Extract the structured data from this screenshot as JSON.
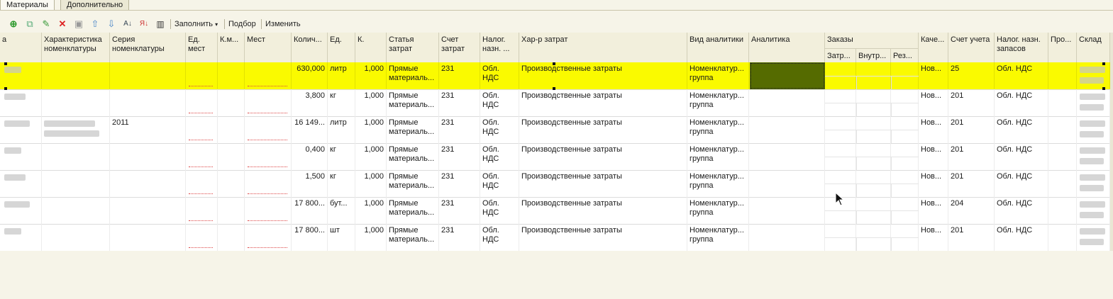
{
  "tabs": [
    {
      "label": "Материалы",
      "active": true
    },
    {
      "label": "Дополнительно",
      "active": false
    }
  ],
  "toolbar": {
    "icons": [
      "add-icon",
      "copy-icon",
      "edit-icon",
      "delete-icon",
      "save-icon",
      "move-up-icon",
      "move-down-icon",
      "sort-asc-icon",
      "sort-desc-icon",
      "barcode-icon"
    ],
    "fill_label": "Заполнить",
    "pick_label": "Подбор",
    "change_label": "Изменить"
  },
  "columns": {
    "a": "а",
    "char": "Характеристика номенклатуры",
    "series": "Серия номенклатуры",
    "unit_places": "Ед. мест",
    "k_places": "К.м...",
    "places": "Мест",
    "qty": "Колич...",
    "unit": "Ед.",
    "k": "К.",
    "cost_item": "Статья затрат",
    "cost_account": "Счет затрат",
    "tax": "Налог. назн. ...",
    "cost_nature": "Хар-р затрат",
    "analytics_type": "Вид аналитики",
    "analytics": "Аналитика",
    "orders": "Заказы",
    "orders_sub": [
      "Затр...",
      "Внутр...",
      "Рез..."
    ],
    "quality": "Каче...",
    "account": "Счет учета",
    "stock_tax": "Налог. назн. запасов",
    "pro": "Про...",
    "warehouse": "Склад"
  },
  "rows": [
    {
      "series": "",
      "qty": "630,000",
      "unit": "литр",
      "k": "1,000",
      "cost_item": "Прямые материаль...",
      "cost_account": "231",
      "tax": "Обл. НДС",
      "cost_nature": "Производственные затраты",
      "analytics_type": "Номенклатур... группа",
      "quality": "Нов...",
      "account": "25",
      "stock_tax": "Обл. НДС"
    },
    {
      "series": "",
      "qty": "3,800",
      "unit": "кг",
      "k": "1,000",
      "cost_item": "Прямые материаль...",
      "cost_account": "231",
      "tax": "Обл. НДС",
      "cost_nature": "Производственные затраты",
      "analytics_type": "Номенклатур... группа",
      "quality": "Нов...",
      "account": "201",
      "stock_tax": "Обл. НДС"
    },
    {
      "series": "2011",
      "qty": "16 149...",
      "unit": "литр",
      "k": "1,000",
      "cost_item": "Прямые материаль...",
      "cost_account": "231",
      "tax": "Обл. НДС",
      "cost_nature": "Производственные затраты",
      "analytics_type": "Номенклатур... группа",
      "quality": "Нов...",
      "account": "201",
      "stock_tax": "Обл. НДС"
    },
    {
      "series": "",
      "qty": "0,400",
      "unit": "кг",
      "k": "1,000",
      "cost_item": "Прямые материаль...",
      "cost_account": "231",
      "tax": "Обл. НДС",
      "cost_nature": "Производственные затраты",
      "analytics_type": "Номенклатур... группа",
      "quality": "Нов...",
      "account": "201",
      "stock_tax": "Обл. НДС"
    },
    {
      "series": "",
      "qty": "1,500",
      "unit": "кг",
      "k": "1,000",
      "cost_item": "Прямые материаль...",
      "cost_account": "231",
      "tax": "Обл. НДС",
      "cost_nature": "Производственные затраты",
      "analytics_type": "Номенклатур... группа",
      "quality": "Нов...",
      "account": "201",
      "stock_tax": "Обл. НДС"
    },
    {
      "series": "",
      "qty": "17 800...",
      "unit": "бут...",
      "k": "1,000",
      "cost_item": "Прямые материаль...",
      "cost_account": "231",
      "tax": "Обл. НДС",
      "cost_nature": "Производственные затраты",
      "analytics_type": "Номенклатур... группа",
      "quality": "Нов...",
      "account": "204",
      "stock_tax": "Обл. НДС"
    },
    {
      "series": "",
      "qty": "17 800...",
      "unit": "шт",
      "k": "1,000",
      "cost_item": "Прямые материаль...",
      "cost_account": "231",
      "tax": "Обл. НДС",
      "cost_nature": "Производственные затраты",
      "analytics_type": "Номенклатур... группа",
      "quality": "Нов...",
      "account": "201",
      "stock_tax": "Обл. НДС"
    }
  ],
  "colors": {
    "selected_row": "#fafa00",
    "selected_cell": "#556b00",
    "background": "#f6f4e8"
  }
}
